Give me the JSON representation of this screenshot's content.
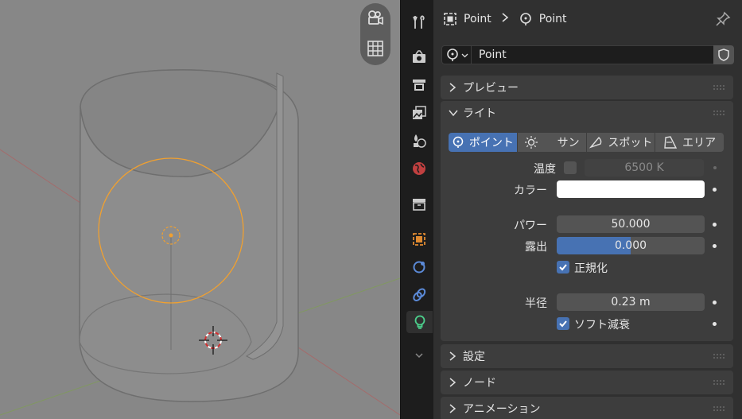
{
  "breadcrumb": {
    "object": "Point",
    "data": "Point"
  },
  "datablock": {
    "name": "Point"
  },
  "panels": {
    "preview": "プレビュー",
    "light": "ライト",
    "settings": "設定",
    "nodes": "ノード",
    "animation": "アニメーション"
  },
  "light_types": [
    {
      "label": "ポイント",
      "icon": "point-light-icon",
      "selected": true
    },
    {
      "label": "サン",
      "icon": "sun-light-icon",
      "selected": false
    },
    {
      "label": "スポット",
      "icon": "spot-light-icon",
      "selected": false
    },
    {
      "label": "エリア",
      "icon": "area-light-icon",
      "selected": false
    }
  ],
  "temperature": {
    "label": "温度",
    "value": "6500 K",
    "enabled": false
  },
  "color": {
    "label": "カラー",
    "value": "#ffffff"
  },
  "power": {
    "label": "パワー",
    "value": "50.000"
  },
  "exposure": {
    "label": "露出",
    "value": "0.000",
    "fill_fraction": 0.5
  },
  "normalize": {
    "label": "正規化",
    "checked": true
  },
  "radius": {
    "label": "半径",
    "value": "0.23 m"
  },
  "soft_falloff": {
    "label": "ソフト減衰",
    "checked": true
  },
  "colors": {
    "accent": "#4772b3",
    "panel": "#3d3d3d",
    "viewport": "#878787",
    "selection": "#f0a030"
  }
}
